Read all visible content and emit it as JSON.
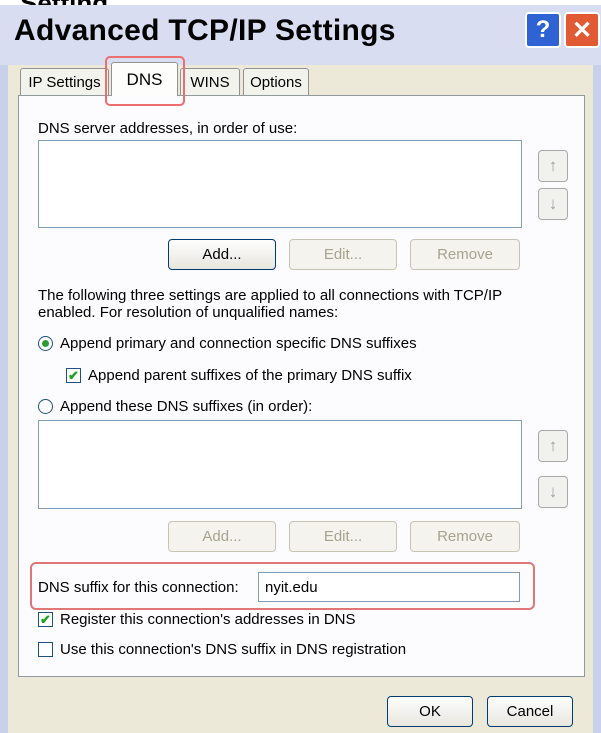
{
  "window": {
    "cutoff_text": "Setting",
    "title": "Advanced TCP/IP Settings",
    "help_glyph": "?",
    "close_glyph": "✕"
  },
  "tabs": [
    {
      "label": "IP Settings"
    },
    {
      "label": "DNS"
    },
    {
      "label": "WINS"
    },
    {
      "label": "Options"
    }
  ],
  "dns": {
    "server_list_label": "DNS server addresses, in order of use:",
    "up_arrow": "↑",
    "down_arrow": "↓",
    "server_buttons": {
      "add": "Add...",
      "edit": "Edit...",
      "remove": "Remove"
    },
    "info_text_line1": "The following three settings are applied to all connections with TCP/IP",
    "info_text_line2": "enabled. For resolution of unqualified names:",
    "radio_primary": "Append primary and connection specific DNS suffixes",
    "check_parent": "Append parent suffixes of the primary DNS suffix",
    "radio_these": "Append these DNS suffixes (in order):",
    "suffix_buttons": {
      "add": "Add...",
      "edit": "Edit...",
      "remove": "Remove"
    },
    "suffix_label": "DNS suffix for this connection:",
    "suffix_value": "nyit.edu",
    "register_label": "Register this connection's addresses in DNS",
    "use_suffix_label": "Use this connection's DNS suffix in DNS registration"
  },
  "footer": {
    "ok": "OK",
    "cancel": "Cancel"
  },
  "state": {
    "selected_tab": "DNS",
    "radio_primary_selected": true,
    "check_parent_checked": true,
    "register_checked": true,
    "use_suffix_checked": false
  },
  "colors": {
    "highlight_box": "#e17676",
    "title_bar": "#d8ddf1",
    "help_button": "#2f63d3",
    "close_button": "#e25a34",
    "check_mark": "#21a121"
  }
}
